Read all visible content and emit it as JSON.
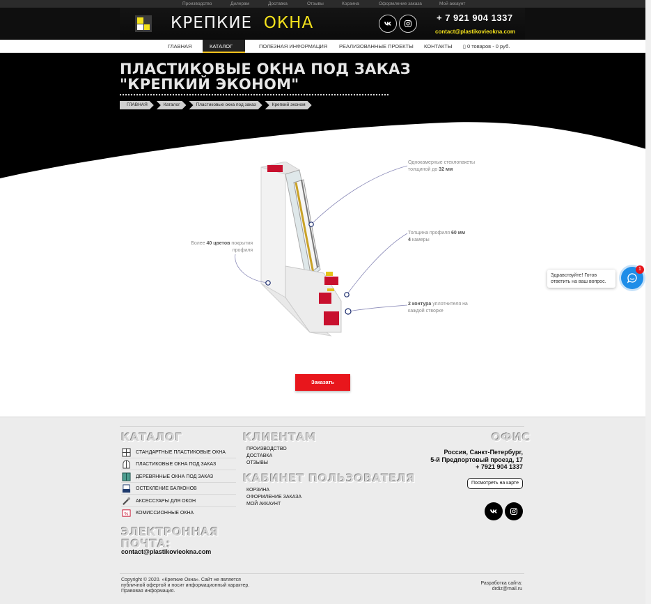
{
  "topbar": {
    "links": [
      "Производство",
      "Дилерам",
      "Доставка",
      "Отзывы",
      "Корзина",
      "Оформление заказа",
      "Мой аккаунт"
    ]
  },
  "header": {
    "logo_part1": "КРЕПКИЕ",
    "logo_part2": "ОКНА",
    "phone": "+ 7 921 904 1337",
    "email": "contact@plastikovieokna.com",
    "colors": {
      "accent": "#f4e21c",
      "dark": "#0f0f0f"
    }
  },
  "nav": {
    "items": [
      "ГЛАВНАЯ",
      "КАТАЛОГ",
      "ПОЛЕЗНАЯ ИНФОРМАЦИЯ",
      "РЕАЛИЗОВАННЫЕ ПРОЕКТЫ",
      "КОНТАКТЫ"
    ],
    "cart": "0 товаров - 0 руб."
  },
  "hero": {
    "title_line1": "ПЛАСТИКОВЫЕ ОКНА ПОД ЗАКАЗ",
    "title_line2": "\"КРЕПКИЙ ЭКОНОМ\"",
    "breadcrumbs": [
      "ГЛАВНАЯ",
      "Каталог",
      "Пластиковые окна под заказ",
      "Крепкий эконом"
    ]
  },
  "diagram": {
    "label_glass_pre": "Однокамерные стеклопакеты толщиной до",
    "label_glass_bold": "32 мм",
    "label_profile_pre": "Толщина профиля",
    "label_profile_bold": "60 мм",
    "label_chambers_bold": "4",
    "label_chambers_post": "камеры",
    "label_colors_pre": "Более",
    "label_colors_bold": "40 цветов",
    "label_colors_post": "покрытия профиля",
    "label_seal_bold": "2 контура",
    "label_seal_post": "уплотнителя на каждой створке"
  },
  "order_button": "Заказать",
  "chat": {
    "message": "Здравствуйте! Готов ответить на ваш вопрос.",
    "badge": "1"
  },
  "footer": {
    "catalog_heading": "КАТАЛОГ",
    "catalog_items": [
      "СТАНДАРТНЫЕ ПЛАСТИКОВЫЕ ОКНА",
      "ПЛАСТИКОВЫЕ ОКНА ПОД ЗАКАЗ",
      "ДЕРЕВЯННЫЕ ОКНА ПОД ЗАКАЗ",
      "ОСТЕКЛЕНИЕ БАЛКОНОВ",
      "АКСЕССУАРЫ ДЛЯ ОКОН",
      "КОМИССИОННЫЕ ОКНА"
    ],
    "clients_heading": "КЛИЕНТАМ",
    "clients_items": [
      "ПРОИЗВОДСТВО",
      "ДОСТАВКА",
      "ОТЗЫВЫ"
    ],
    "cabinet_heading": "КАБИНЕТ ПОЛЬЗОВАТЕЛЯ",
    "cabinet_items": [
      "КОРЗИНА",
      "ОФОРМЛЕНИЕ ЗАКАЗА",
      "МОЙ АККАУНТ"
    ],
    "office_heading": "ОФИС",
    "office_city": "Россия, Санкт-Петербург,",
    "office_street": "5-й Предпортовый проезд, 17",
    "office_phone": "+ 7921 904 1337",
    "map_button": "Посмотреть на карте",
    "email_heading_1": "ЭЛЕКТРОННАЯ",
    "email_heading_2": "ПОЧТА:",
    "email": "contact@plastikovieokna.com",
    "copyright_1": "Copyright © 2020. «Крепкие Окна». Сайт не является",
    "copyright_2": "публичной офертой и носит информационный характер.",
    "copyright_3": "Правовая информация.",
    "dev_1": "Разработка сайта:",
    "dev_2": "drdiz@mail.ru"
  }
}
